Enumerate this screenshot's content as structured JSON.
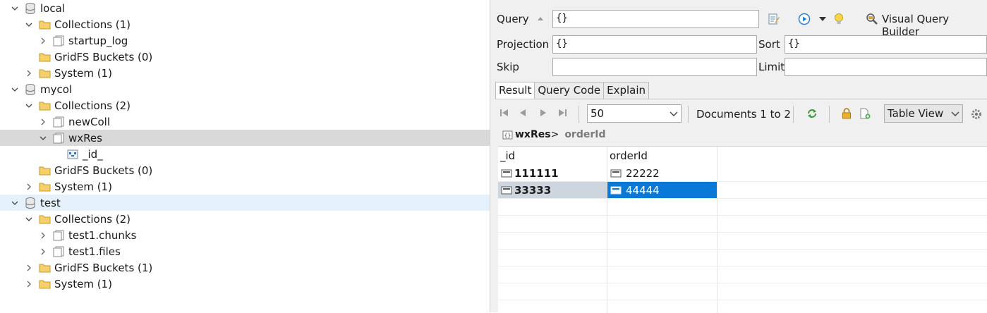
{
  "tree": {
    "databases": [
      {
        "name": "local",
        "collections_label": "Collections (1)",
        "collections": [
          {
            "name": "startup_log"
          }
        ],
        "gridfs_label": "GridFS Buckets (0)",
        "system_label": "System (1)"
      },
      {
        "name": "mycol",
        "collections_label": "Collections (2)",
        "collections": [
          {
            "name": "newColl"
          },
          {
            "name": "wxRes",
            "children": [
              {
                "name": "_id_"
              }
            ]
          }
        ],
        "gridfs_label": "GridFS Buckets (0)",
        "system_label": "System (1)"
      },
      {
        "name": "test",
        "collections_label": "Collections (2)",
        "collections": [
          {
            "name": "test1.chunks"
          },
          {
            "name": "test1.files"
          }
        ],
        "gridfs_label": "GridFS Buckets (1)",
        "system_label": "System (1)"
      }
    ]
  },
  "query": {
    "query_label": "Query",
    "query_value": "{}",
    "projection_label": "Projection",
    "projection_value": "{}",
    "sort_label": "Sort",
    "sort_value": "{}",
    "skip_label": "Skip",
    "skip_value": "",
    "limit_label": "Limit",
    "limit_value": "",
    "vqb_label": "Visual Query Builder"
  },
  "tabs": [
    {
      "label": "Result"
    },
    {
      "label": "Query Code"
    },
    {
      "label": "Explain"
    }
  ],
  "toolbar": {
    "page_size": "50",
    "documents_label": "Documents 1 to 2",
    "view_mode": "Table View"
  },
  "breadcrumb": {
    "collection": "wxRes",
    "sep": ">",
    "field": "orderId"
  },
  "grid": {
    "columns": [
      {
        "label": "_id"
      },
      {
        "label": "orderId"
      }
    ],
    "rows": [
      {
        "id": "111111",
        "orderId": "22222"
      },
      {
        "id": "33333",
        "orderId": "44444"
      }
    ]
  },
  "colors": {
    "tree_selected": "#d9d9d9",
    "tree_hover": "#e5f1fb",
    "cell_selected": "#0a78d7",
    "folder": "#e8b84a"
  }
}
